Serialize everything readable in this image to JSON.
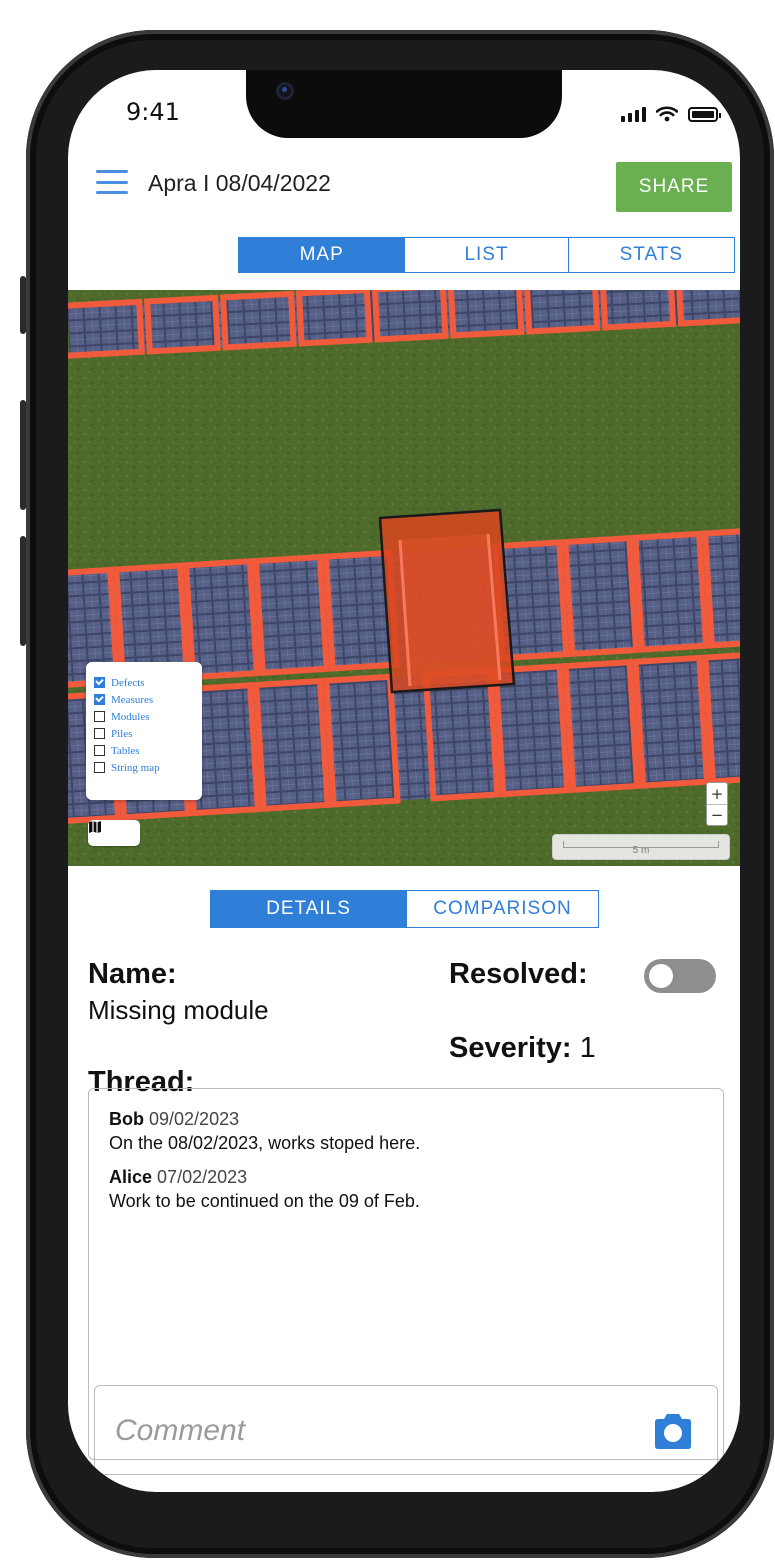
{
  "status_bar": {
    "time": "9:41"
  },
  "header": {
    "title": "Apra I 08/04/2022",
    "share_label": "SHARE"
  },
  "view_tabs": [
    {
      "label": "MAP",
      "active": true
    },
    {
      "label": "LIST",
      "active": false
    },
    {
      "label": "STATS",
      "active": false
    }
  ],
  "map": {
    "layers": [
      {
        "label": "Defects",
        "checked": true
      },
      {
        "label": "Measures",
        "checked": true
      },
      {
        "label": "Modules",
        "checked": false
      },
      {
        "label": "Piles",
        "checked": false
      },
      {
        "label": "Tables",
        "checked": false
      },
      {
        "label": "String map",
        "checked": false
      }
    ],
    "zoom_in": "+",
    "zoom_out": "−",
    "scale_label": "5 m"
  },
  "detail_tabs": [
    {
      "label": "DETAILS",
      "active": true
    },
    {
      "label": "COMPARISON",
      "active": false
    }
  ],
  "details": {
    "name_label": "Name:",
    "name_value": "Missing module",
    "resolved_label": "Resolved:",
    "resolved": false,
    "severity_label": "Severity:",
    "severity_value": "1",
    "thread_label": "Thread:"
  },
  "thread": {
    "messages": [
      {
        "author": "Bob",
        "date": "09/02/2023",
        "text": "On the 08/02/2023, works stoped here."
      },
      {
        "author": "Alice",
        "date": "07/02/2023",
        "text": "Work to be continued on the 09 of Feb."
      }
    ],
    "comment_placeholder": "Comment"
  },
  "colors": {
    "accent": "#2f7fd8",
    "share": "#6aaf50",
    "panel_outline": "#f25a3c",
    "defect_fill": "#d9461e"
  }
}
